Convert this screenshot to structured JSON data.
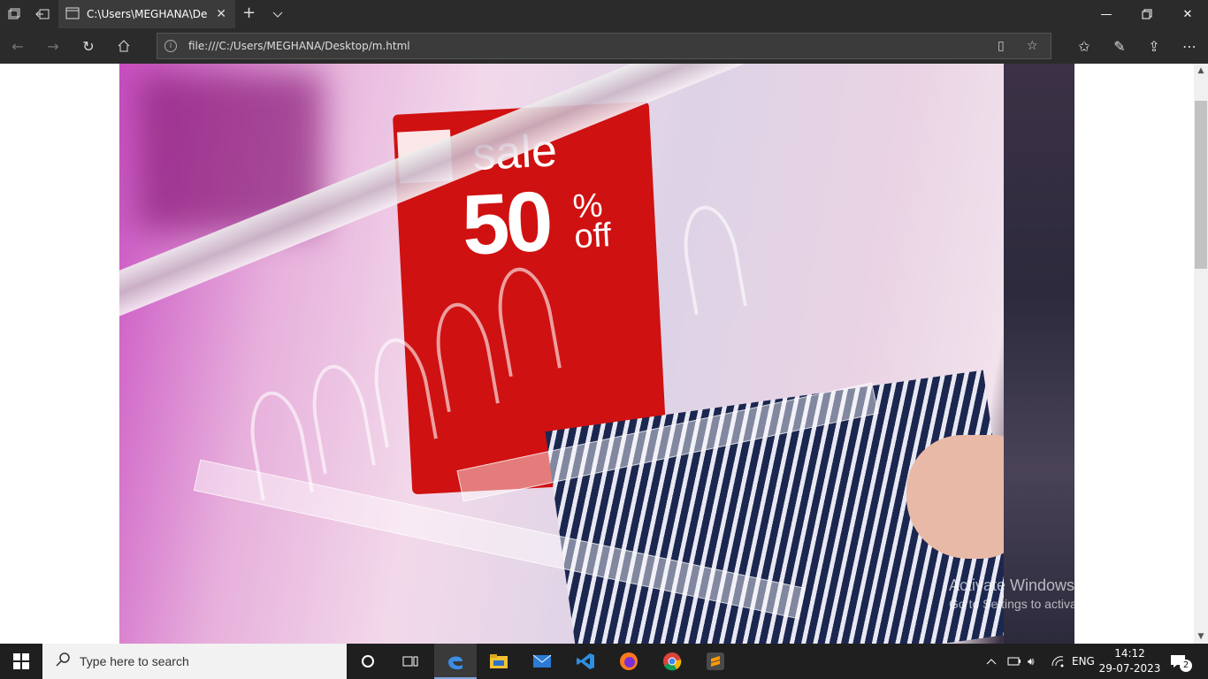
{
  "browser": {
    "tab_title": "C:\\Users\\MEGHANA\\De",
    "address": "file:///C:/Users/MEGHANA/Desktop/m.html"
  },
  "page": {
    "image_sign": {
      "word": "sale",
      "number": "50",
      "percent": "%",
      "off": "off"
    }
  },
  "watermark": {
    "line1": "Activate Windows",
    "line2": "Go to Settings to activate Windows."
  },
  "taskbar": {
    "search_placeholder": "Type here to search",
    "language": "ENG",
    "time": "14:12",
    "date": "29-07-2023",
    "notifications": "2"
  }
}
